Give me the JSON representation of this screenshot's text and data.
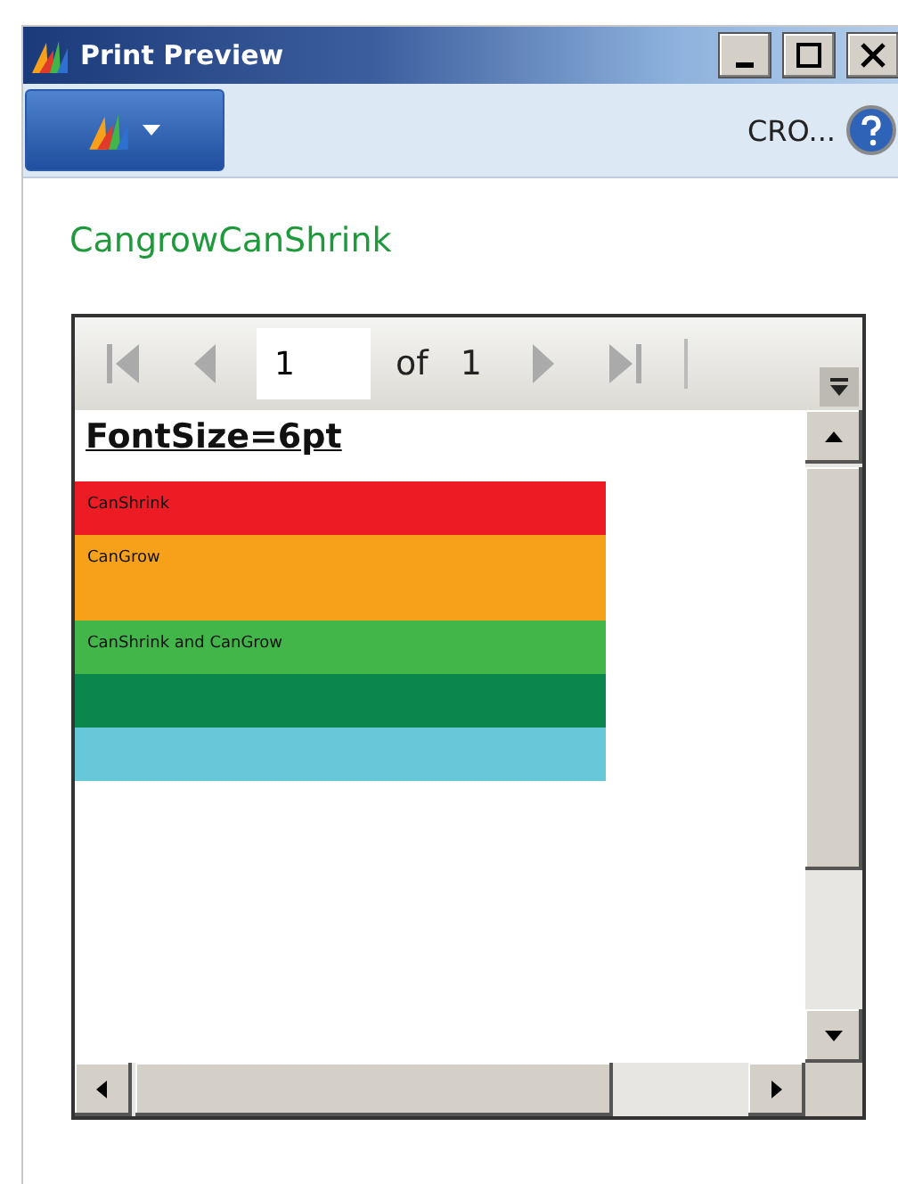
{
  "window": {
    "title": "Print Preview"
  },
  "toolbar": {
    "company": "CRO..."
  },
  "heading": "CangrowCanShrink",
  "viewer": {
    "page": "1",
    "of_label": "of",
    "page_count": "1",
    "report_title": "FontSize=6pt",
    "bands": [
      {
        "text": "CanShrink",
        "color": "#ed1c24"
      },
      {
        "text": "CanGrow",
        "color": "#f7a11b",
        "kind": "tall"
      },
      {
        "text": "CanShrink and CanGrow",
        "color": "#43b649"
      },
      {
        "color": "#0b864c"
      },
      {
        "color": "#67c8da"
      }
    ]
  }
}
